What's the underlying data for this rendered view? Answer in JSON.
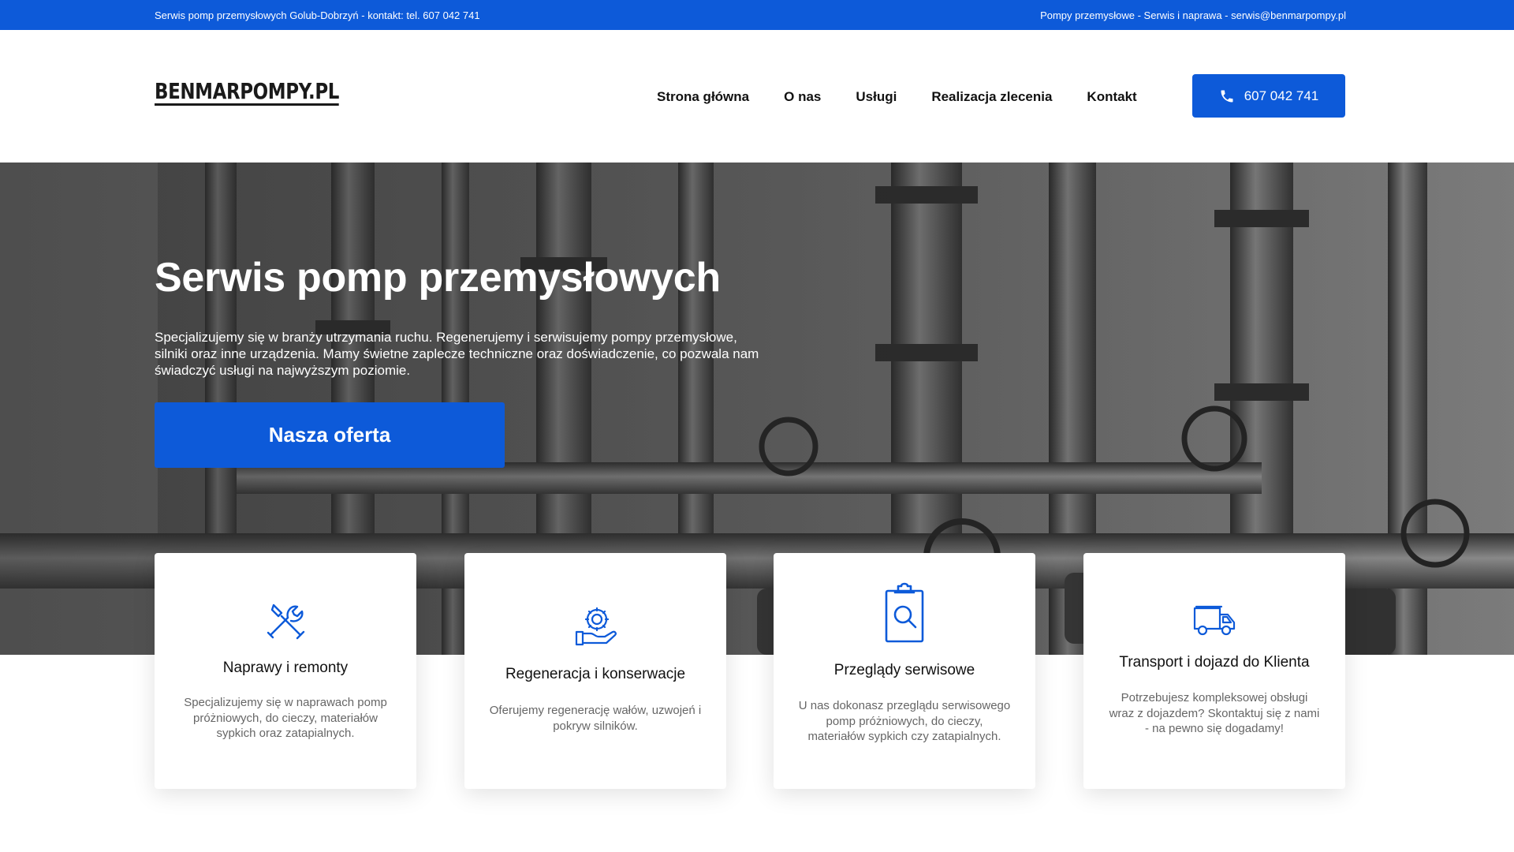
{
  "topbar": {
    "left_text": "Serwis pomp przemysłowych Golub-Dobrzyń - kontakt: tel. 607 042 741",
    "right_text": "Pompy przemysłowe - Serwis i naprawa - serwis@benmarpompy.pl"
  },
  "header": {
    "logo": "BENMARPOMPY.PL",
    "nav": [
      "Strona główna",
      "O nas",
      "Usługi",
      "Realizacja zlecenia",
      "Kontakt"
    ],
    "call_button": {
      "icon": "phone-icon",
      "label": "607 042 741"
    }
  },
  "hero": {
    "title": "Serwis pomp przemysłowych",
    "text": "Specjalizujemy się w branży utrzymania ruchu. Regenerujemy i serwisujemy pompy przemysłowe, silniki oraz inne urządzenia. Mamy świetne zaplecze techniczne oraz doświadczenie, co pozwala nam świadczyć usługi na najwyższym poziomie.",
    "button": "Nasza oferta"
  },
  "cards": [
    {
      "icon": "wrench-screwdriver-icon",
      "title": "Naprawy i remonty",
      "description": "Specjalizujemy się w naprawach pomp próżniowych, do cieczy, materiałów sypkich oraz zatapialnych."
    },
    {
      "icon": "hand-gear-icon",
      "title": "Regeneracja i konserwacje",
      "description": "Oferujemy regenerację wałów, uzwojeń i pokryw silników."
    },
    {
      "icon": "clipboard-search-icon",
      "title": "Przeglądy serwisowe",
      "description": "U nas dokonasz przeglądu serwisowego pomp próżniowych, do cieczy, materiałów sypkich czy zatapialnych."
    },
    {
      "icon": "delivery-truck-icon",
      "title": "Transport i dojazd do Klienta",
      "description": "Potrzebujesz kompleksowej obsługi wraz z dojazdem? Skontaktuj się z nami - na pewno się dogadamy!"
    }
  ],
  "colors": {
    "brand_blue": "#0d5ad9",
    "hero_gray": "#4a4a4a",
    "text_dark": "#111111",
    "text_muted": "#666666"
  }
}
